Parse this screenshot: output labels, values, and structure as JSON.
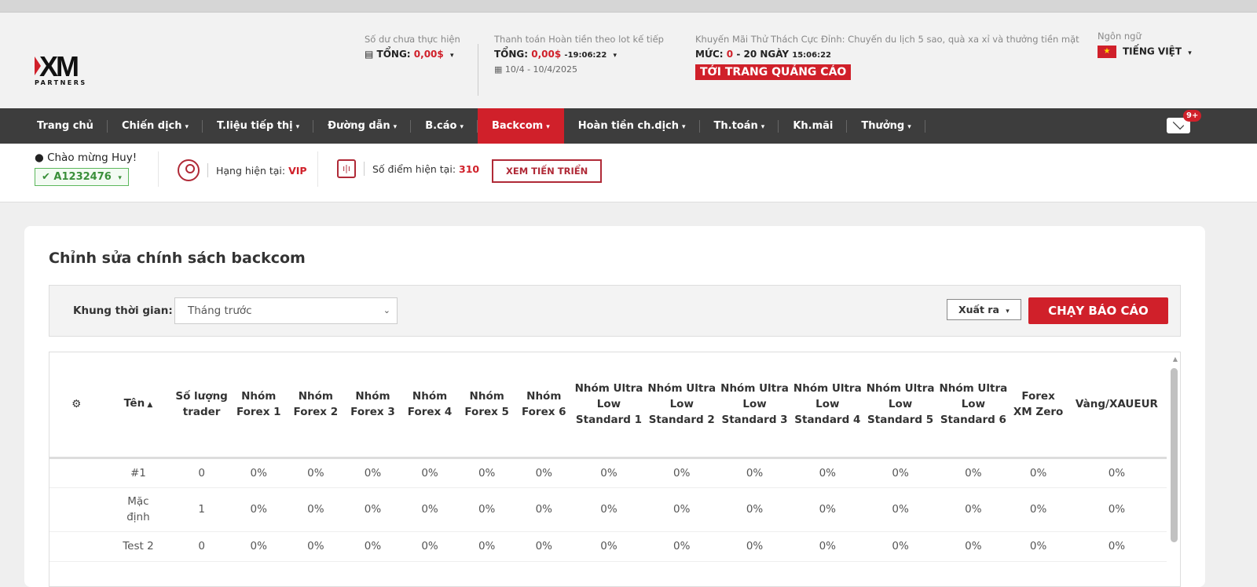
{
  "logo": {
    "brand": "XM",
    "sub": "PARTNERS"
  },
  "header": {
    "balance": {
      "label": "Số dư chưa thực hiện",
      "total_label": "TỔNG:",
      "total_value": "0,00$"
    },
    "payout": {
      "label": "Thanh toán Hoàn tiền theo lot kế tiếp",
      "total_label": "TỔNG:",
      "total_value": "0,00$",
      "countdown": "-19:06:22",
      "date_range": "10/4 - 10/4/2025"
    },
    "promo": {
      "label": "Khuyến Mãi Thử Thách Cực Đỉnh: Chuyến du lịch 5 sao, quà xa xỉ và thưởng tiền mặt",
      "level_label": "MỨC:",
      "level_value": "0",
      "level_rest": "- 20 NGÀY",
      "time": "15:06:22",
      "button": "TỚI TRANG QUẢNG CÁO"
    },
    "language": {
      "label": "Ngôn ngữ",
      "value": "TIẾNG VIỆT"
    }
  },
  "nav": {
    "items": [
      {
        "label": "Trang chủ",
        "dropdown": false
      },
      {
        "label": "Chiến dịch",
        "dropdown": true
      },
      {
        "label": "T.liệu tiếp thị",
        "dropdown": true
      },
      {
        "label": "Đường dẫn",
        "dropdown": true
      },
      {
        "label": "B.cáo",
        "dropdown": true
      },
      {
        "label": "Backcom",
        "dropdown": true,
        "active": true
      },
      {
        "label": "Hoàn tiền ch.dịch",
        "dropdown": true
      },
      {
        "label": "Th.toán",
        "dropdown": true
      },
      {
        "label": "Kh.mãi",
        "dropdown": false
      },
      {
        "label": "Thưởng",
        "dropdown": true
      }
    ],
    "mail_badge": "9+"
  },
  "user": {
    "welcome": "Chào mừng Huy!",
    "account": "A1232476",
    "rank_label": "Hạng hiện tại:",
    "rank_value": "VIP",
    "points_label": "Số điểm hiện tại:",
    "points_value": "310",
    "progress_button": "XEM TIẾN TRIỂN"
  },
  "page": {
    "title": "Chỉnh sửa chính sách backcom",
    "filter": {
      "label": "Khung thời gian:",
      "selected": "Tháng trước",
      "export": "Xuất ra",
      "run": "CHẠY BÁO CÁO"
    },
    "table": {
      "columns": [
        "Tên",
        "Số lượng trader",
        "Nhóm Forex 1",
        "Nhóm Forex 2",
        "Nhóm Forex 3",
        "Nhóm Forex 4",
        "Nhóm Forex 5",
        "Nhóm Forex 6",
        "Nhóm Ultra Low Standard 1",
        "Nhóm Ultra Low Standard 2",
        "Nhóm Ultra Low Standard 3",
        "Nhóm Ultra Low Standard 4",
        "Nhóm Ultra Low Standard 5",
        "Nhóm Ultra Low Standard 6",
        "Forex XM Zero",
        "Vàng/XAUEUR"
      ],
      "sort": "Tên ascending",
      "rows": [
        [
          "#1",
          "0",
          "0%",
          "0%",
          "0%",
          "0%",
          "0%",
          "0%",
          "0%",
          "0%",
          "0%",
          "0%",
          "0%",
          "0%",
          "0%",
          "0%"
        ],
        [
          "Mặc định",
          "1",
          "0%",
          "0%",
          "0%",
          "0%",
          "0%",
          "0%",
          "0%",
          "0%",
          "0%",
          "0%",
          "0%",
          "0%",
          "0%",
          "0%"
        ],
        [
          "Test 2",
          "0",
          "0%",
          "0%",
          "0%",
          "0%",
          "0%",
          "0%",
          "0%",
          "0%",
          "0%",
          "0%",
          "0%",
          "0%",
          "0%",
          "0%"
        ]
      ]
    }
  },
  "colors": {
    "accent": "#d0202a",
    "nav_bg": "#3d3d3d",
    "success": "#5cb85c"
  }
}
